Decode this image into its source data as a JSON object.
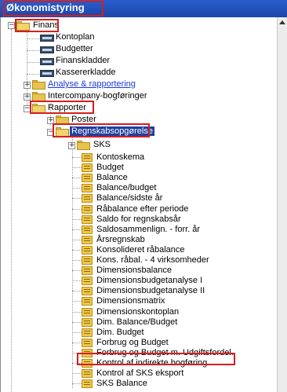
{
  "window": {
    "title": "Økonomistyring"
  },
  "tree": {
    "finans": "Finans",
    "finans_items": [
      "Kontoplan",
      "Budgetter",
      "Finanskladder",
      "Kassererkladde"
    ],
    "analyse": "Analyse & rapportering",
    "intercompany": "Intercompany-bogføringer",
    "rapporter": "Rapporter",
    "poster": "Poster",
    "regnskab": "Regnskabsopgørelse",
    "sks": "SKS",
    "reports": [
      "Kontoskema",
      "Budget",
      "Balance",
      "Balance/budget",
      "Balance/sidste år",
      "Råbalance efter periode",
      "Saldo for regnskabsår",
      "Saldosammenlign. - forr. år",
      "Årsregnskab",
      "Konsolideret råbalance",
      "Kons. råbal. - 4 virksomheder",
      "Dimensionsbalance",
      "Dimensionsbudgetanalyse I",
      "Dimensionsbudgetanalyse II",
      "Dimensionsmatrix",
      "Dimensionskontoplan",
      "Dim. Balance/Budget",
      "Dim. Budget",
      "Forbrug og Budget",
      "Forbrug og Budget m. Udgiftsfordel.",
      "Kontrol af indirekte bogføring",
      "Kontrol af SKS eksport",
      "SKS Balance"
    ]
  }
}
